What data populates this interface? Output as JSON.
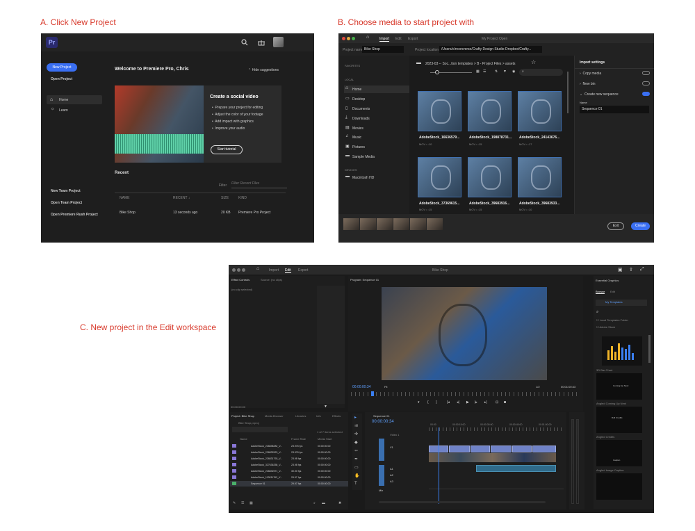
{
  "captions": {
    "a": "A.  Click New Project",
    "b": "B.  Choose media to start project with",
    "c": "C.  New project in the Edit workspace"
  },
  "home": {
    "logo": "Pr",
    "new_project": "New Project",
    "open_project": "Open Project",
    "nav": [
      {
        "label": "Home",
        "icon": "home-icon"
      },
      {
        "label": "Learn",
        "icon": "bulb-icon"
      }
    ],
    "welcome": "Welcome to Premiere Pro, Chris",
    "hide_suggestions": "Hide suggestions",
    "card_title": "Create a social video",
    "card_bullets": [
      "Prepare your project for editing",
      "Adjust the color of your footage",
      "Add impact with graphics",
      "Improve your audio"
    ],
    "start_tutorial": "Start tutorial",
    "recent": "Recent",
    "filter_label": "Filter",
    "filter_placeholder": "Filter Recent Files",
    "columns": [
      "NAME",
      "RECENT",
      "SIZE",
      "KIND"
    ],
    "recent_rows": [
      {
        "name": "Bike Shop",
        "recent": "13 seconds ago",
        "size": "20 KB",
        "kind": "Premiere Pro Project"
      }
    ],
    "bottom_links": [
      "New Team Project",
      "Open Team Project",
      "Open Premiere Rush Project"
    ]
  },
  "import": {
    "tabs": [
      "Import",
      "Edit",
      "Export"
    ],
    "window_title": "My Project Open",
    "project_name_label": "Project name",
    "project_name_value": "Bike Shop",
    "project_location_label": "Project location",
    "project_location_value": "/Users/c/rrconverse/Crafty Design Studio Dropbox/Crafty...",
    "favorites_header": "FAVORITES",
    "local_header": "LOCAL",
    "local_items": [
      {
        "label": "Home",
        "icon": "home-icon"
      },
      {
        "label": "Desktop",
        "icon": "desktop-icon"
      },
      {
        "label": "Documents",
        "icon": "document-icon"
      },
      {
        "label": "Downloads",
        "icon": "download-icon"
      },
      {
        "label": "Movies",
        "icon": "movie-icon"
      },
      {
        "label": "Music",
        "icon": "music-icon"
      },
      {
        "label": "Pictures",
        "icon": "picture-icon"
      },
      {
        "label": "Sample Media",
        "icon": "folder-icon"
      }
    ],
    "devices_header": "DEVICES",
    "device_items": [
      {
        "label": "Macintosh HD",
        "icon": "disk-icon"
      }
    ],
    "breadcrumb": "2023-03 -- Soc...tion templates  >  B - Project Files  >  assets",
    "files": [
      {
        "name": "AdobeStock_16636579...",
        "meta": "MOV • :10"
      },
      {
        "name": "AdobeStock_198878731...",
        "meta": "MOV • :15"
      },
      {
        "name": "AdobeStock_24143676...",
        "meta": "MOV • :17"
      },
      {
        "name": "AdobeStock_37369615...",
        "meta": "MOV • :15"
      },
      {
        "name": "AdobeStock_39683916...",
        "meta": "MOV • :15"
      },
      {
        "name": "AdobeStock_39683933...",
        "meta": "MOV • :10"
      }
    ],
    "settings_header": "Import settings",
    "settings": [
      {
        "label": "Copy media",
        "on": false
      },
      {
        "label": "New bin",
        "on": false
      },
      {
        "label": "Create new sequence",
        "on": true
      }
    ],
    "name_label": "Name",
    "name_value": "Sequence 01",
    "exit": "Exit",
    "create": "Create"
  },
  "edit": {
    "tabs": [
      "Import",
      "Edit",
      "Export"
    ],
    "window_title": "Bike Shop",
    "effect_controls_tab": "Effect Controls",
    "source_tab": "Source: (no clips)",
    "no_clip": "(no clip selected)",
    "program_title": "Program: Sequence 01",
    "timecode_left": "00:00:00:34",
    "fit": "Fit",
    "quality": "1/2",
    "timecode_right": "00:01:00:43",
    "source_time": "00:00:00:00",
    "project_tabs": [
      "Project: Bike Shop",
      "Media Browser",
      "Libraries",
      "Info",
      "Effects"
    ],
    "project_file": "Bike Shop.prproj",
    "items_selected": "1 of 7 items selected",
    "project_columns": [
      "Name",
      "Frame Rate",
      "Media Start"
    ],
    "project_rows": [
      {
        "name": "AdobeStock_226838282_V...",
        "rate": "23.976 fps",
        "start": "00:00:00:00"
      },
      {
        "name": "AdobeStock_226832523_V...",
        "rate": "23.976 fps",
        "start": "00:00:00:00"
      },
      {
        "name": "AdobeStock_226831793_V...",
        "rate": "23.98 fps",
        "start": "00:00:00:00"
      },
      {
        "name": "AdobeStock_327636258_V...",
        "rate": "23.98 fps",
        "start": "00:00:00:00"
      },
      {
        "name": "AdobeStock_226832571_V...",
        "rate": "30.00 fps",
        "start": "00:00:00:00"
      },
      {
        "name": "AdobeStock_113031762_V...",
        "rate": "29.97 fps",
        "start": "00:00:00:00"
      },
      {
        "name": "Sequence 01",
        "rate": "29.97 fps",
        "start": "00:00:00:00"
      }
    ],
    "sequence_tab": "Sequence 01",
    "seq_timecode": "00:00:00:34",
    "ruler": [
      "00:00",
      "00:00:15:00",
      "00:00:30:00",
      "00:00:45:00",
      "00:01:00:00"
    ],
    "tracks": [
      "V1",
      "A1",
      "A2",
      "A3",
      "Mix"
    ],
    "video_label": "Video 1",
    "eg_title": "Essential Graphics",
    "eg_tabs": [
      "Browse",
      "Edit"
    ],
    "my_templates": "My Templates",
    "local_templates": "Local Templates Folder",
    "adobe_stock": "Adobe Stock",
    "templates": [
      "3D Bar Chart",
      "Angled Coming Up Next",
      "Angled Credits",
      "Angled Image Caption"
    ],
    "template_text": [
      "Coming Up Next:",
      "Roll Credits",
      "Caption"
    ]
  }
}
